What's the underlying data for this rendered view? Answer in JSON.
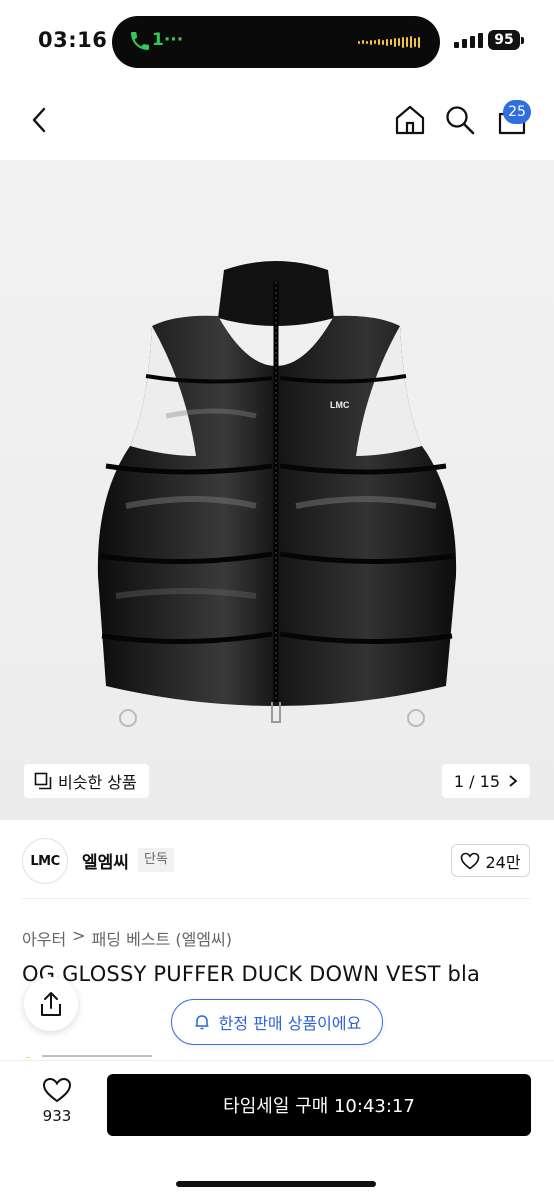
{
  "status_bar": {
    "time": "03:16",
    "call_text": "1···",
    "battery": "95"
  },
  "nav": {
    "cart_count": "25",
    "icons": [
      "chevron-left-icon",
      "home-icon",
      "search-icon",
      "bag-icon"
    ]
  },
  "gallery": {
    "similar_label": "비슷한 상품",
    "counter": "1 / 15",
    "logo_text": "LMC"
  },
  "brand": {
    "logo_text": "LMC",
    "name": "엘엠씨",
    "exclusive_badge": "단독",
    "like_count": "24만"
  },
  "breadcrumb": {
    "category": "아우터",
    "separator": ">",
    "subcategory": "패딩 베스트 (엘엠씨)"
  },
  "product": {
    "title": "OG GLOSSY PUFFER DUCK DOWN VEST bla"
  },
  "notice": {
    "limited_label": "한정 판매 상품이에요"
  },
  "bottom_bar": {
    "wish_count": "933",
    "buy_label": "타임세일 구매 10:43:17"
  },
  "colors": {
    "accent_blue": "#2f6fe0",
    "call_green": "#34c759",
    "buy_button": "#000000"
  }
}
